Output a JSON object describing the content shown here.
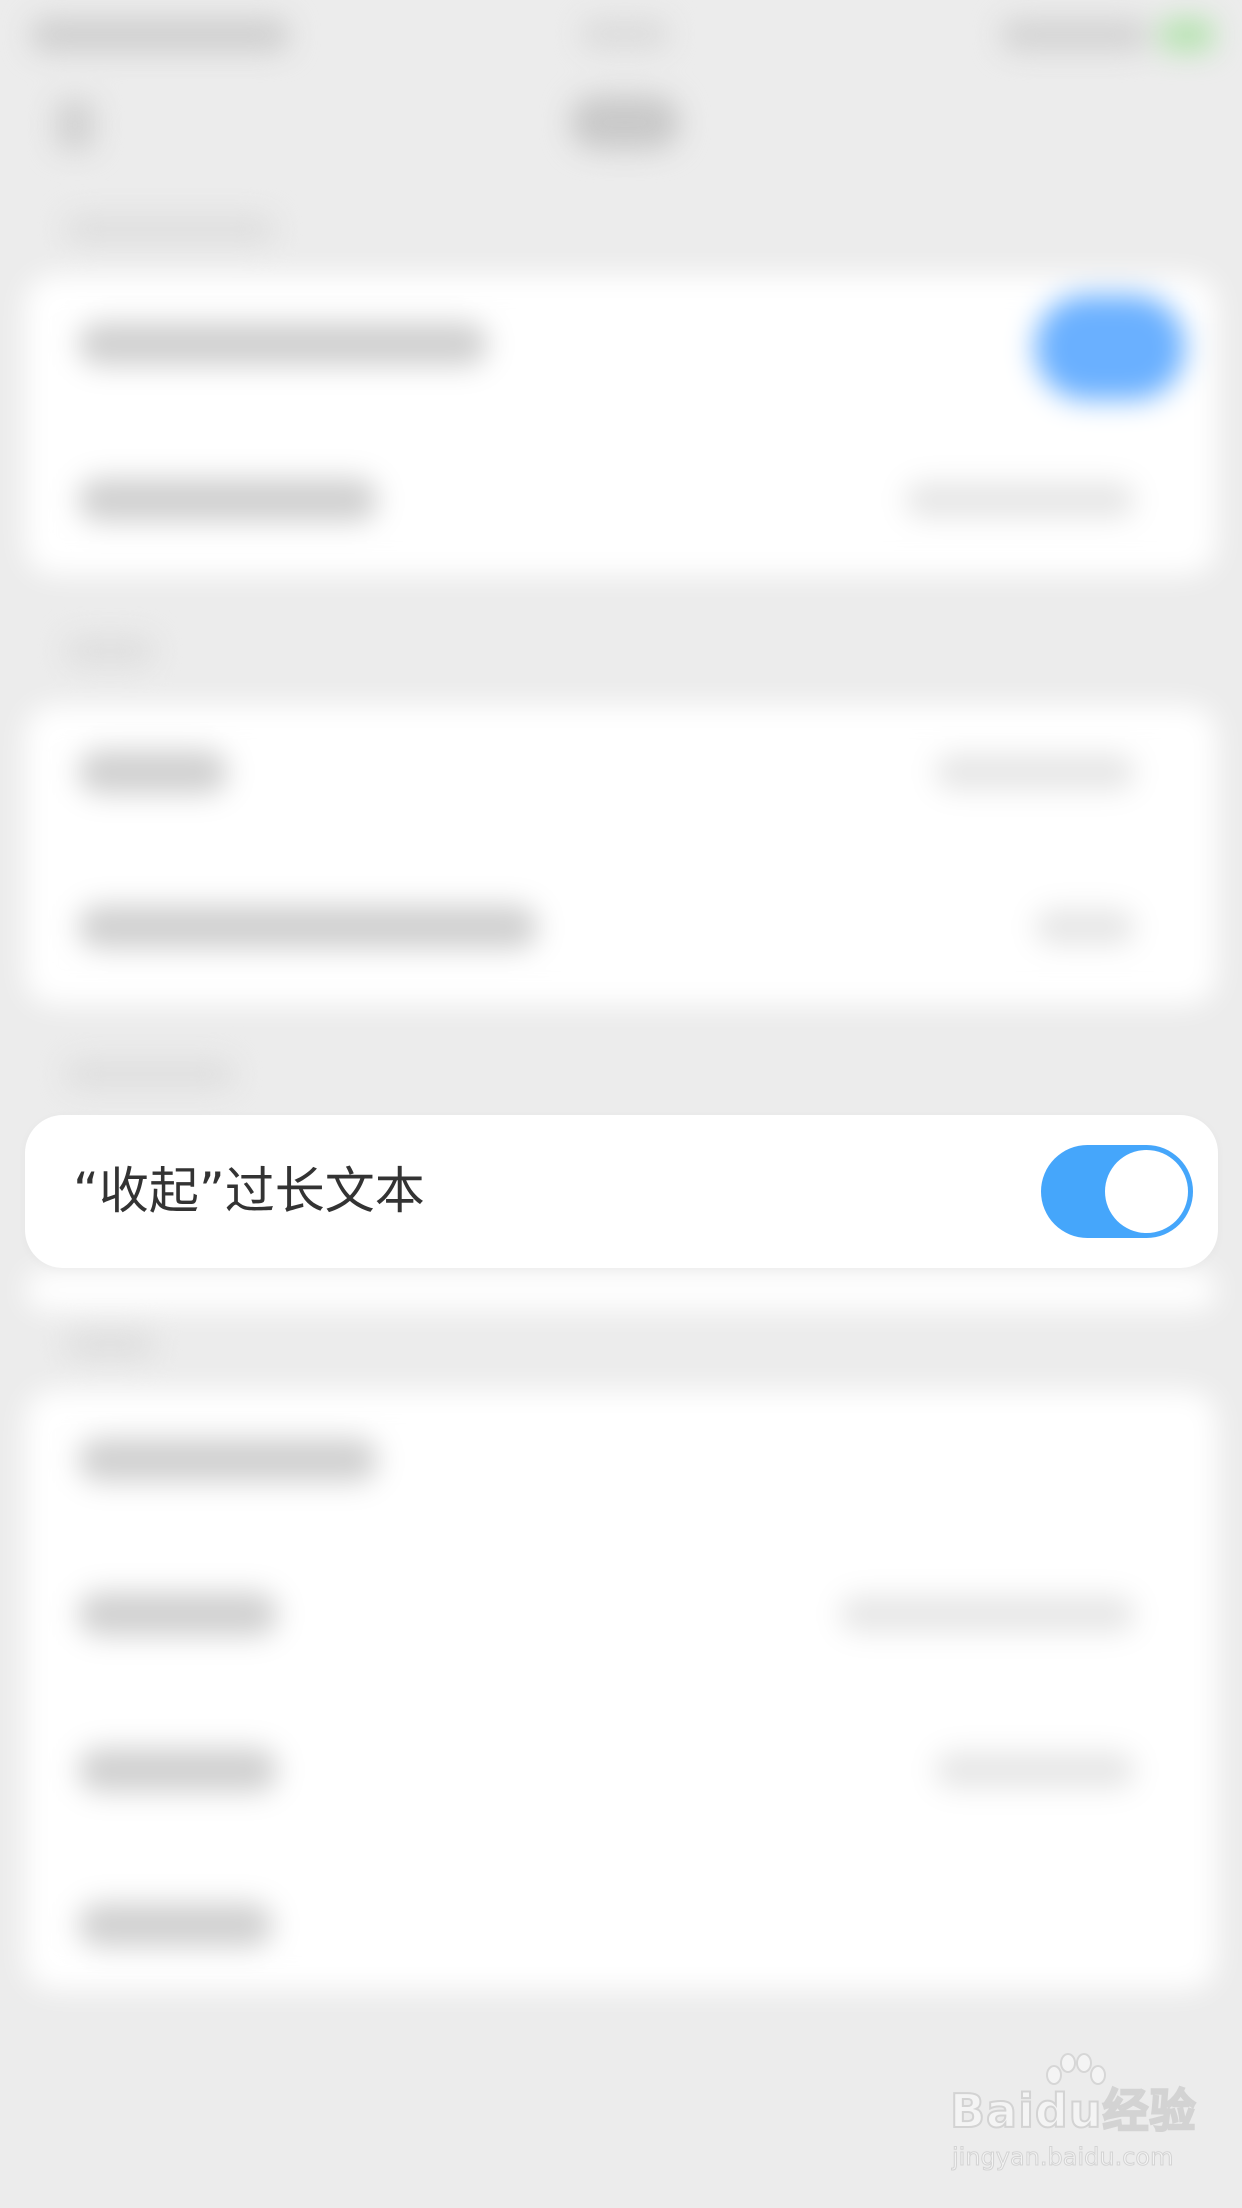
{
  "setting": {
    "label": "“收起”过长文本",
    "enabled": true
  },
  "colors": {
    "accent": "#45a6fb",
    "card": "#ffffff",
    "background": "#ececec",
    "text": "#333333"
  },
  "icons": {
    "toggle_knob": "circle"
  },
  "watermark": {
    "brand": "Baidu经验",
    "site": "jingyan.baidu.com"
  }
}
